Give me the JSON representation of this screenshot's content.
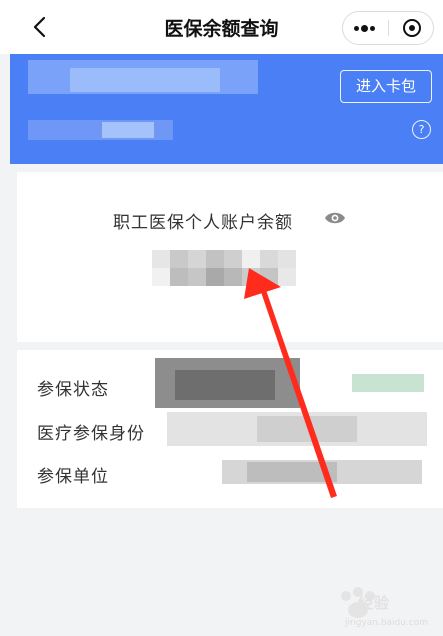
{
  "navbar": {
    "title": "医保余额查询",
    "back_icon": "chevron-left-icon",
    "more_icon": "more-dots-icon",
    "close_icon": "record-circle-icon"
  },
  "card": {
    "enter_wallet_label": "进入卡包",
    "help_symbol": "?",
    "accent_color": "#4a7ff5"
  },
  "account": {
    "balance_label": "职工医保个人账户余额",
    "eye_icon": "eye-icon"
  },
  "info": {
    "rows": [
      {
        "label": "参保状态"
      },
      {
        "label": "医疗参保身份"
      },
      {
        "label": "参保单位"
      }
    ]
  },
  "annotation": {
    "arrow_color": "#ff2b1c"
  },
  "watermark": {
    "text": "经验",
    "sub": "jingyan.baidu.com"
  }
}
